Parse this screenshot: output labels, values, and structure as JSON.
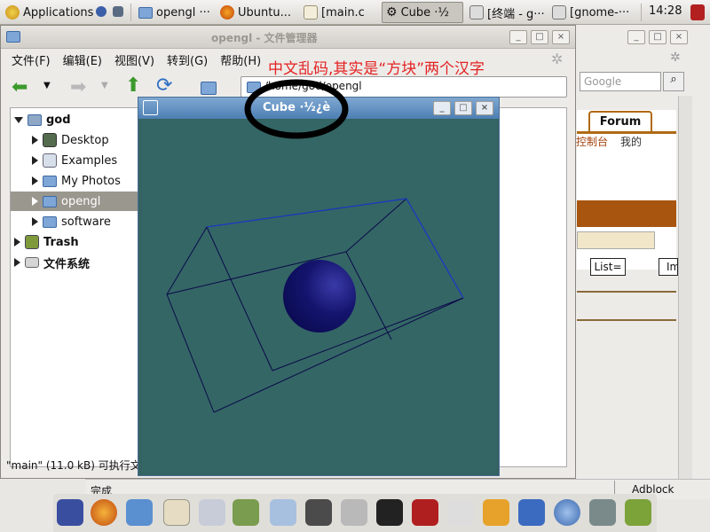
{
  "top_panel": {
    "applications": "Applications",
    "tasks": [
      {
        "label": "opengl ···"
      },
      {
        "label": "Ubuntu..."
      },
      {
        "label": "[main.c"
      },
      {
        "label": "Cube ·½"
      },
      {
        "label": "[终端 - g···"
      },
      {
        "label": "[gnome-···"
      }
    ],
    "clock": "14:28"
  },
  "file_manager": {
    "title": "opengl - 文件管理器",
    "menu": [
      "文件(F)",
      "编辑(E)",
      "视图(V)",
      "转到(G)",
      "帮助(H)"
    ],
    "location": "/home/god/opengl",
    "tree": [
      {
        "label": "god",
        "bold": true
      },
      {
        "label": "Desktop"
      },
      {
        "label": "Examples"
      },
      {
        "label": "My Photos"
      },
      {
        "label": "opengl"
      },
      {
        "label": "software"
      },
      {
        "label": "Trash",
        "bold": true
      },
      {
        "label": "文件系统",
        "bold": true
      }
    ],
    "status": "\"main\" (11.0 kB) 可执行文"
  },
  "cube_window": {
    "title": "Cube ·½¿è"
  },
  "annotation": "中文乱码,其实是“方块”两个汉字",
  "firefox": {
    "search_placeholder": "Google",
    "tab_forum": "Forum",
    "link1": "控制台",
    "link2": "我的",
    "list_button": "List=",
    "im_button": "Im",
    "status_left": "完成",
    "status_right": "Adblock"
  },
  "colors": {
    "cube_bg": "#346665",
    "wire": "#0a0a4a",
    "sphere": "#14146e",
    "annotation": "#e32222"
  }
}
